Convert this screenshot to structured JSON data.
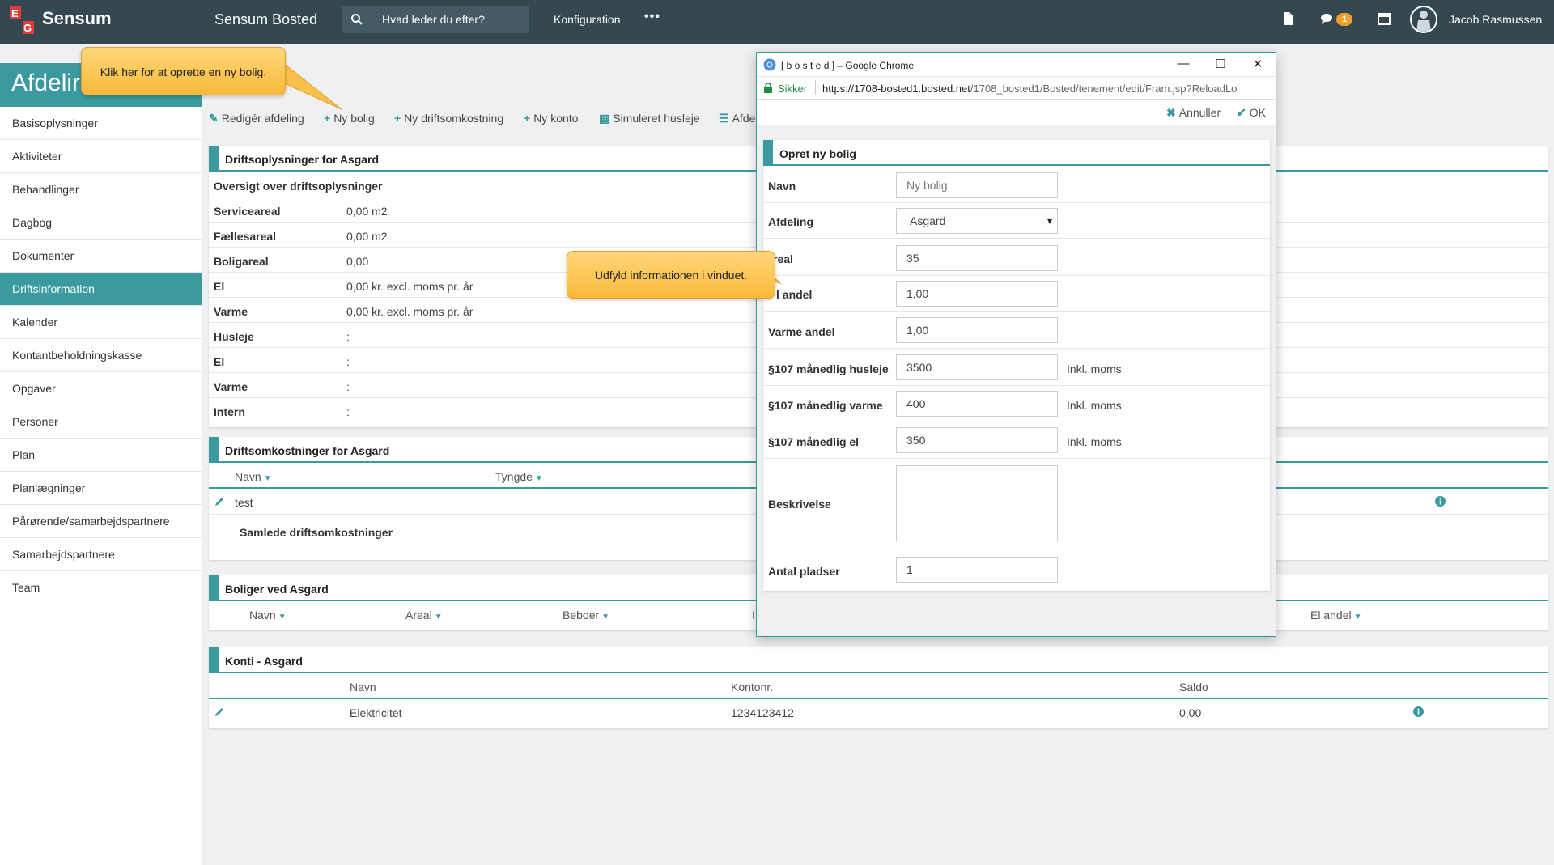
{
  "topbar": {
    "logo_text": "Sensum",
    "app_name": "Sensum Bosted",
    "search_placeholder": "Hvad leder du efter?",
    "nav_config": "Konfiguration",
    "nav_more": "•••",
    "notification_count": "1",
    "user_name": "Jacob Rasmussen"
  },
  "page": {
    "title": "Afdelir"
  },
  "sidebar": {
    "items": [
      {
        "label": "Basisoplysninger"
      },
      {
        "label": "Aktiviteter"
      },
      {
        "label": "Behandlinger"
      },
      {
        "label": "Dagbog"
      },
      {
        "label": "Dokumenter"
      },
      {
        "label": "Driftsinformation",
        "active": true
      },
      {
        "label": "Kalender"
      },
      {
        "label": "Kontantbeholdningskasse"
      },
      {
        "label": "Opgaver"
      },
      {
        "label": "Personer"
      },
      {
        "label": "Plan"
      },
      {
        "label": "Planlægninger"
      },
      {
        "label": "Pårørende/samarbejdspartnere"
      },
      {
        "label": "Samarbejdspartnere"
      },
      {
        "label": "Team"
      }
    ]
  },
  "toolbar": {
    "edit": "Redigér afdeling",
    "new_home": "Ny bolig",
    "new_cost": "Ny driftsomkostning",
    "new_account": "Ny konto",
    "simulated_rent": "Simuleret husleje",
    "afde": "Afde"
  },
  "drift": {
    "title": "Driftsoplysninger for Asgard",
    "subtitle": "Oversigt over driftsoplysninger",
    "rows": [
      {
        "k": "Serviceareal",
        "v": "0,00 m2"
      },
      {
        "k": "Fællesareal",
        "v": "0,00 m2"
      },
      {
        "k": "Boligareal",
        "v": "0,00"
      },
      {
        "k": "El",
        "v": "0,00 kr. excl. moms pr. år"
      },
      {
        "k": "Varme",
        "v": "0,00 kr. excl. moms pr. år"
      },
      {
        "k": "Husleje",
        "v": ":"
      },
      {
        "k": "El",
        "v": ":"
      },
      {
        "k": "Varme",
        "v": ":"
      },
      {
        "k": "Intern",
        "v": ":"
      }
    ]
  },
  "costs": {
    "title": "Driftsomkostninger for Asgard",
    "col_name": "Navn",
    "col_weight": "Tyngde",
    "row_name": "test",
    "total": "Samlede driftsomkostninger"
  },
  "homes": {
    "title": "Boliger ved Asgard",
    "col_name": "Navn",
    "col_area": "Areal",
    "col_resident": "Beboer",
    "col_clip": "I",
    "col_el": "El andel"
  },
  "accounts": {
    "title": "Konti - Asgard",
    "col_name": "Navn",
    "col_number": "Kontonr.",
    "col_balance": "Saldo",
    "row_name": "Elektricitet",
    "row_number": "1234123412",
    "row_balance": "0,00"
  },
  "popup": {
    "window_title": "[ b o s t e d ] – Google Chrome",
    "minimize": "—",
    "maximize": "☐",
    "close": "✕",
    "secure": "Sikker",
    "url_host": "https://1708-bosted1.bosted.net",
    "url_path": "/1708_bosted1/Bosted/tenement/edit/Fram.jsp?ReloadLo",
    "cancel": "Annuller",
    "ok": "OK",
    "form_title": "Opret ny bolig",
    "fields": {
      "name_label": "Navn",
      "name_placeholder": "Ny bolig",
      "dept_label": "Afdeling",
      "dept_value": "Asgard",
      "area_label": "real",
      "area_value": "35",
      "el_label": "l andel",
      "el_value": "1,00",
      "heat_label": "Varme andel",
      "heat_value": "1,00",
      "rent_label": "§107 månedlig husleje",
      "rent_value": "3500",
      "heatm_label": "§107 månedlig varme",
      "heatm_value": "400",
      "elm_label": "§107 månedlig el",
      "elm_value": "350",
      "unit": "Inkl. moms",
      "desc_label": "Beskrivelse",
      "places_label": "Antal pladser",
      "places_value": "1"
    }
  },
  "tooltips": {
    "new_home": "Klik her for at oprette en ny bolig.",
    "fill_info": "Udfyld informationen i vinduet."
  },
  "colors": {
    "topbar": "#35474f",
    "accent": "#3a9a9f",
    "tooltip": "#f9b93a"
  }
}
